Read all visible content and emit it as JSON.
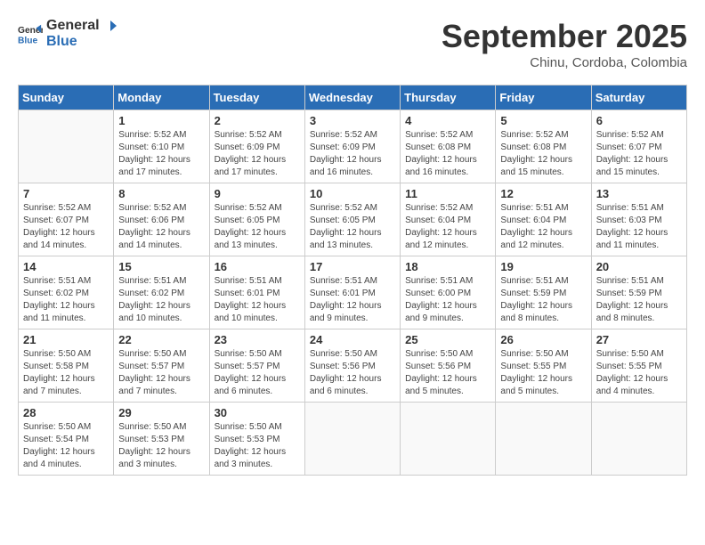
{
  "logo": {
    "line1": "General",
    "line2": "Blue"
  },
  "title": "September 2025",
  "subtitle": "Chinu, Cordoba, Colombia",
  "weekdays": [
    "Sunday",
    "Monday",
    "Tuesday",
    "Wednesday",
    "Thursday",
    "Friday",
    "Saturday"
  ],
  "weeks": [
    [
      {
        "day": "",
        "info": ""
      },
      {
        "day": "1",
        "info": "Sunrise: 5:52 AM\nSunset: 6:10 PM\nDaylight: 12 hours\nand 17 minutes."
      },
      {
        "day": "2",
        "info": "Sunrise: 5:52 AM\nSunset: 6:09 PM\nDaylight: 12 hours\nand 17 minutes."
      },
      {
        "day": "3",
        "info": "Sunrise: 5:52 AM\nSunset: 6:09 PM\nDaylight: 12 hours\nand 16 minutes."
      },
      {
        "day": "4",
        "info": "Sunrise: 5:52 AM\nSunset: 6:08 PM\nDaylight: 12 hours\nand 16 minutes."
      },
      {
        "day": "5",
        "info": "Sunrise: 5:52 AM\nSunset: 6:08 PM\nDaylight: 12 hours\nand 15 minutes."
      },
      {
        "day": "6",
        "info": "Sunrise: 5:52 AM\nSunset: 6:07 PM\nDaylight: 12 hours\nand 15 minutes."
      }
    ],
    [
      {
        "day": "7",
        "info": "Sunrise: 5:52 AM\nSunset: 6:07 PM\nDaylight: 12 hours\nand 14 minutes."
      },
      {
        "day": "8",
        "info": "Sunrise: 5:52 AM\nSunset: 6:06 PM\nDaylight: 12 hours\nand 14 minutes."
      },
      {
        "day": "9",
        "info": "Sunrise: 5:52 AM\nSunset: 6:05 PM\nDaylight: 12 hours\nand 13 minutes."
      },
      {
        "day": "10",
        "info": "Sunrise: 5:52 AM\nSunset: 6:05 PM\nDaylight: 12 hours\nand 13 minutes."
      },
      {
        "day": "11",
        "info": "Sunrise: 5:52 AM\nSunset: 6:04 PM\nDaylight: 12 hours\nand 12 minutes."
      },
      {
        "day": "12",
        "info": "Sunrise: 5:51 AM\nSunset: 6:04 PM\nDaylight: 12 hours\nand 12 minutes."
      },
      {
        "day": "13",
        "info": "Sunrise: 5:51 AM\nSunset: 6:03 PM\nDaylight: 12 hours\nand 11 minutes."
      }
    ],
    [
      {
        "day": "14",
        "info": "Sunrise: 5:51 AM\nSunset: 6:02 PM\nDaylight: 12 hours\nand 11 minutes."
      },
      {
        "day": "15",
        "info": "Sunrise: 5:51 AM\nSunset: 6:02 PM\nDaylight: 12 hours\nand 10 minutes."
      },
      {
        "day": "16",
        "info": "Sunrise: 5:51 AM\nSunset: 6:01 PM\nDaylight: 12 hours\nand 10 minutes."
      },
      {
        "day": "17",
        "info": "Sunrise: 5:51 AM\nSunset: 6:01 PM\nDaylight: 12 hours\nand 9 minutes."
      },
      {
        "day": "18",
        "info": "Sunrise: 5:51 AM\nSunset: 6:00 PM\nDaylight: 12 hours\nand 9 minutes."
      },
      {
        "day": "19",
        "info": "Sunrise: 5:51 AM\nSunset: 5:59 PM\nDaylight: 12 hours\nand 8 minutes."
      },
      {
        "day": "20",
        "info": "Sunrise: 5:51 AM\nSunset: 5:59 PM\nDaylight: 12 hours\nand 8 minutes."
      }
    ],
    [
      {
        "day": "21",
        "info": "Sunrise: 5:50 AM\nSunset: 5:58 PM\nDaylight: 12 hours\nand 7 minutes."
      },
      {
        "day": "22",
        "info": "Sunrise: 5:50 AM\nSunset: 5:57 PM\nDaylight: 12 hours\nand 7 minutes."
      },
      {
        "day": "23",
        "info": "Sunrise: 5:50 AM\nSunset: 5:57 PM\nDaylight: 12 hours\nand 6 minutes."
      },
      {
        "day": "24",
        "info": "Sunrise: 5:50 AM\nSunset: 5:56 PM\nDaylight: 12 hours\nand 6 minutes."
      },
      {
        "day": "25",
        "info": "Sunrise: 5:50 AM\nSunset: 5:56 PM\nDaylight: 12 hours\nand 5 minutes."
      },
      {
        "day": "26",
        "info": "Sunrise: 5:50 AM\nSunset: 5:55 PM\nDaylight: 12 hours\nand 5 minutes."
      },
      {
        "day": "27",
        "info": "Sunrise: 5:50 AM\nSunset: 5:55 PM\nDaylight: 12 hours\nand 4 minutes."
      }
    ],
    [
      {
        "day": "28",
        "info": "Sunrise: 5:50 AM\nSunset: 5:54 PM\nDaylight: 12 hours\nand 4 minutes."
      },
      {
        "day": "29",
        "info": "Sunrise: 5:50 AM\nSunset: 5:53 PM\nDaylight: 12 hours\nand 3 minutes."
      },
      {
        "day": "30",
        "info": "Sunrise: 5:50 AM\nSunset: 5:53 PM\nDaylight: 12 hours\nand 3 minutes."
      },
      {
        "day": "",
        "info": ""
      },
      {
        "day": "",
        "info": ""
      },
      {
        "day": "",
        "info": ""
      },
      {
        "day": "",
        "info": ""
      }
    ]
  ]
}
